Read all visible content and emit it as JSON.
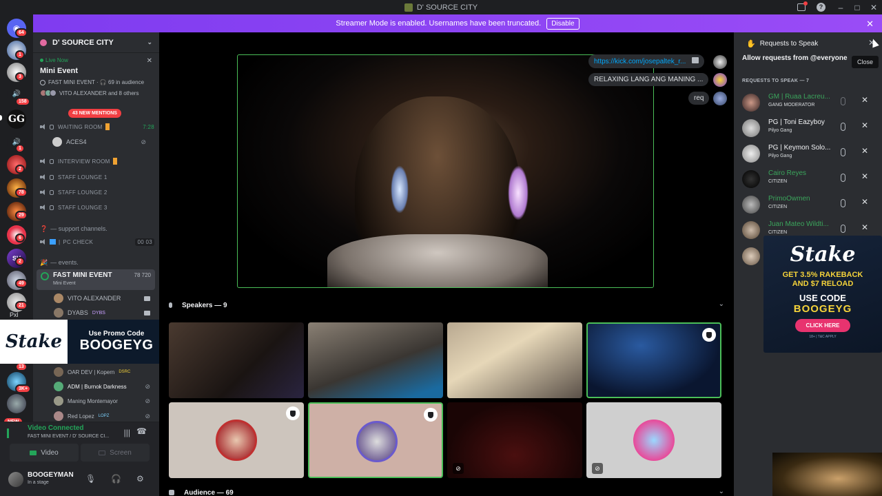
{
  "titlebar": {
    "title": "D' SOURCE CITY"
  },
  "banner": {
    "text": "Streamer Mode is enabled. Usernames have been truncated.",
    "button": "Disable"
  },
  "rail": {
    "badges": [
      "64",
      "1",
      "3",
      "158",
      "1",
      "2",
      "78",
      "29",
      "6",
      "2",
      "49",
      "21",
      "13",
      "3K+"
    ],
    "new_label": "NEW",
    "pxl_label": "Pxl"
  },
  "guild": {
    "name": "D' SOURCE CITY"
  },
  "event": {
    "live": "Live Now",
    "title": "Mini Event",
    "meta": "FAST MINI EVENT · 🎧 69 in audience",
    "people": "VITO ALEXANDER and 8 others"
  },
  "mentions": "43 NEW MENTIONS",
  "channels": {
    "waiting": "WAITING ROOM",
    "waiting_time": "7:28",
    "aces": "ACES4",
    "interview": "INTERVIEW ROOM",
    "staff1": "STAFF LOUNGE 1",
    "staff2": "STAFF LOUNGE 2",
    "staff3": "STAFF LOUNGE 3",
    "support_cat": "— support channels.",
    "pccheck": "PC CHECK",
    "pccheck_counts": "00 03",
    "events_cat": "— events.",
    "fast_mini": "FAST MINI EVENT",
    "fast_mini_sub": "Mini Event",
    "fast_mini_stats": "78 720"
  },
  "members": [
    "VITO ALEXANDER",
    "DYABS",
    "OAR DEV | Kopern",
    "ADM | Burnok Darkness",
    "Maning Montemayor",
    "Red Lopez"
  ],
  "member_tags": {
    "dyabs": "DYBS",
    "oar": "DSRC",
    "red": "LOPZ"
  },
  "promo_left": {
    "brand": "Stake",
    "line1": "Use Promo Code",
    "code": "BOOGEYG"
  },
  "voice": {
    "status": "Video Connected",
    "where": "FAST MINI EVENT / D' SOURCE CI...",
    "video_btn": "Video",
    "screen_btn": "Screen"
  },
  "user": {
    "name": "BOOGEYMAN",
    "status": "In a stage"
  },
  "stage": {
    "chat": [
      {
        "text": "https://kick.com/josepaltek_r..."
      },
      {
        "text": "RELAXING LANG ANG MANING ..."
      },
      {
        "text": "req"
      }
    ],
    "speakers_label": "Speakers — 9",
    "audience_label": "Audience — 69"
  },
  "requests": {
    "header": "Requests to Speak",
    "allow": "Allow requests from @everyone",
    "tooltip": "Close",
    "section": "REQUESTS TO SPEAK — 7",
    "items": [
      {
        "name": "GM | Ruaa Lacreu...",
        "role": "GANG MODERATOR"
      },
      {
        "name": "PG | Toni Eazyboy",
        "role": "Pilyo Gang"
      },
      {
        "name": "PG | Keymon Solo...",
        "role": "Pilyo Gang"
      },
      {
        "name": "Cairo Reyes",
        "role": "CITIZEN"
      },
      {
        "name": "PrimoOwmen",
        "role": "CITIZEN"
      },
      {
        "name": "Juan Mateo Wildti...",
        "role": "CITIZEN"
      }
    ]
  },
  "stake_ad": {
    "brand": "Stake",
    "line1": "GET 3.5% RAKEBACK",
    "line2": "AND $7 RELOAD",
    "line3": "USE CODE",
    "code": "BOOGEYG",
    "cta": "CLICK HERE",
    "tc": "18+ | T&C APPLY"
  },
  "colors": {
    "accent": "#5865f2",
    "banner": "#8b45f3",
    "speaking": "#4bbf58",
    "danger": "#f23f43",
    "stake_yellow": "#f5d33a",
    "stake_pink": "#e8336f"
  }
}
